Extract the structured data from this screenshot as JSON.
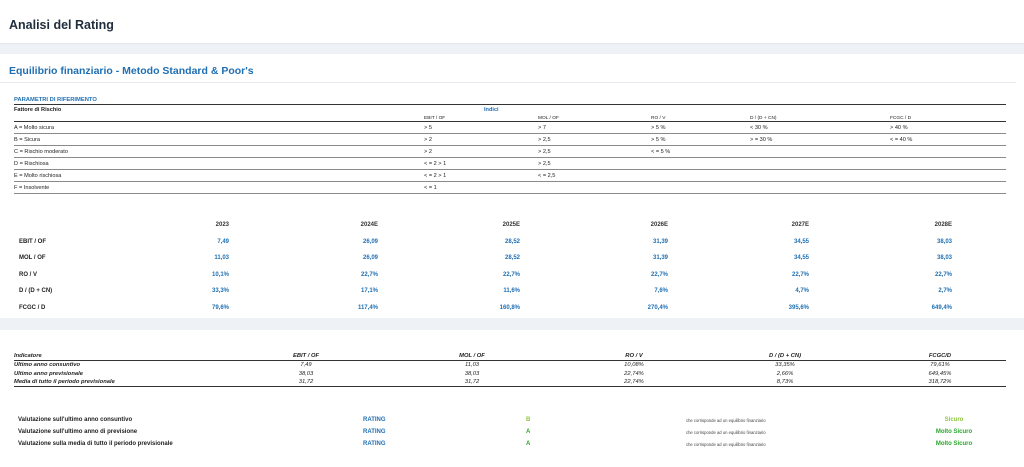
{
  "page_title": "Analisi del Rating",
  "section_title": "Equilibrio finanziario - Metodo Standard & Poor's",
  "reference": {
    "heading": "PARAMETRI DI RIFERIMENTO",
    "factor_label": "Fattore di Rischio",
    "indices_label": "Indici",
    "columns": [
      "EBIT / OF",
      "MOL / OF",
      "RO / V",
      "D / (D + CN)",
      "FCGC / D"
    ],
    "rows": [
      {
        "factor": "A = Molto sicura",
        "values": [
          "> 5",
          "> 7",
          "> 5 %",
          "< 30 %",
          "> 40 %"
        ]
      },
      {
        "factor": "B = Sicura",
        "values": [
          "> 2",
          "> 2,5",
          "> 5 %",
          "> = 30 %",
          "< = 40 %"
        ]
      },
      {
        "factor": "C = Rischio moderato",
        "values": [
          "> 2",
          "> 2,5",
          "< = 5 %",
          "",
          ""
        ]
      },
      {
        "factor": "D = Rischiosa",
        "values": [
          "< = 2 > 1",
          "> 2,5",
          "",
          "",
          ""
        ]
      },
      {
        "factor": "E = Molto rischiosa",
        "values": [
          "< = 2 > 1",
          "< = 2,5",
          "",
          "",
          ""
        ]
      },
      {
        "factor": "F = Insolvente",
        "values": [
          "< = 1",
          "",
          "",
          "",
          ""
        ]
      }
    ]
  },
  "years": {
    "headers": [
      "2023",
      "2024E",
      "2025E",
      "2026E",
      "2027E",
      "2028E"
    ],
    "rows": [
      {
        "label": "EBIT / OF",
        "values": [
          "7,49",
          "26,09",
          "28,52",
          "31,39",
          "34,55",
          "38,03"
        ]
      },
      {
        "label": "MOL / OF",
        "values": [
          "11,03",
          "26,09",
          "28,52",
          "31,39",
          "34,55",
          "38,03"
        ]
      },
      {
        "label": "RO / V",
        "values": [
          "10,1%",
          "22,7%",
          "22,7%",
          "22,7%",
          "22,7%",
          "22,7%"
        ]
      },
      {
        "label": "D / (D + CN)",
        "values": [
          "33,3%",
          "17,1%",
          "11,6%",
          "7,6%",
          "4,7%",
          "2,7%"
        ]
      },
      {
        "label": "FCGC / D",
        "values": [
          "79,6%",
          "117,4%",
          "160,8%",
          "270,4%",
          "395,6%",
          "649,4%"
        ]
      }
    ]
  },
  "summary": {
    "header_label": "Indicatore",
    "columns": [
      "EBIT / OF",
      "MOL / OF",
      "RO / V",
      "D / (D + CN)",
      "FCGC/D"
    ],
    "rows": [
      {
        "label": "Ultimo anno consuntivo",
        "values": [
          "7,49",
          "11,03",
          "10,08%",
          "33,35%",
          "79,61%"
        ]
      },
      {
        "label": "Ultimo anno previsionale",
        "values": [
          "38,03",
          "38,03",
          "22,74%",
          "2,66%",
          "649,45%"
        ]
      },
      {
        "label": "Media di tutto il periodo previsionale",
        "values": [
          "31,72",
          "31,72",
          "22,74%",
          "8,73%",
          "318,72%"
        ]
      }
    ]
  },
  "ratings": {
    "rows": [
      {
        "label": "Valutazione sull'ultimo anno consuntivo",
        "rating": "RATING",
        "letter": "B",
        "desc": "che corrisponde ad un equilibrio finanziario",
        "verdict": "Sicuro",
        "color": "#8cc63f"
      },
      {
        "label": "Valutazione sull'ultimo anno di previsione",
        "rating": "RATING",
        "letter": "A",
        "desc": "che corrisponde ad un equilibrio finanziario",
        "verdict": "Molto Sicuro",
        "color": "#2aa52a"
      },
      {
        "label": "Valutazione sulla media di tutto il periodo previsionale",
        "rating": "RATING",
        "letter": "A",
        "desc": "che corrisponde ad un equilibrio finanziario",
        "verdict": "Molto Sicuro",
        "color": "#2aa52a"
      }
    ]
  }
}
